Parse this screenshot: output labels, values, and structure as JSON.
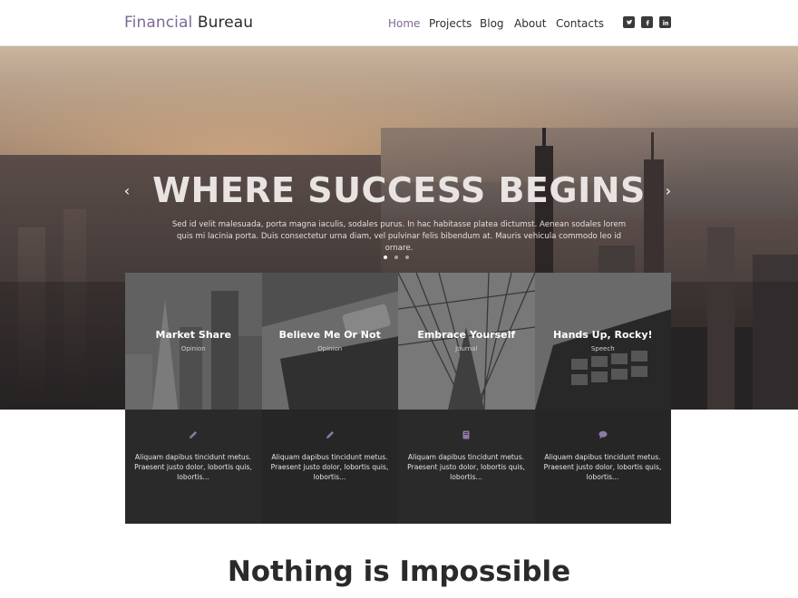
{
  "brand": {
    "part1": "Financial",
    "part2": "Bureau"
  },
  "nav": [
    "Home",
    "Projects",
    "Blog",
    "About",
    "Contacts"
  ],
  "nav_active": "Home",
  "social": [
    "twitter-icon",
    "facebook-icon",
    "linkedin-icon"
  ],
  "hero": {
    "title": "WHERE SUCCESS BEGINS",
    "text": "Sed id velit malesuada, porta magna iaculis, sodales purus. In hac habitasse platea dictumst. Aenean sodales lorem quis mi lacinia porta. Duis consectetur urna diam, vel pulvinar felis bibendum at. Mauris vehicula commodo leo id ornare."
  },
  "cards": [
    {
      "title": "Market Share",
      "tag": "Opinion",
      "icon": "pencil-icon",
      "text": "Aliquam dapibus tincidunt metus. Praesent justo dolor, lobortis quis, lobortis..."
    },
    {
      "title": "Believe Me Or Not",
      "tag": "Opinion",
      "icon": "pencil-icon",
      "text": "Aliquam dapibus tincidunt metus. Praesent justo dolor, lobortis quis, lobortis..."
    },
    {
      "title": "Embrace Yourself",
      "tag": "Journal",
      "icon": "book-icon",
      "text": "Aliquam dapibus tincidunt metus. Praesent justo dolor, lobortis quis, lobortis..."
    },
    {
      "title": "Hands Up, Rocky!",
      "tag": "Speech",
      "icon": "speech-bubble-icon",
      "text": "Aliquam dapibus tincidunt metus. Praesent justo dolor, lobortis quis, lobortis..."
    }
  ],
  "section_title": "Nothing is Impossible",
  "colors": {
    "accent": "#7d6a96",
    "dark": "#2a2a2a"
  }
}
